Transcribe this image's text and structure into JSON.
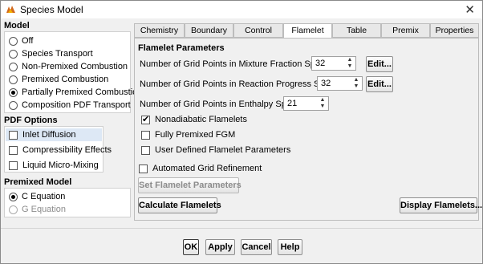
{
  "window": {
    "title": "Species Model",
    "close_icon": "close-icon"
  },
  "model": {
    "title": "Model",
    "options": [
      {
        "label": "Off",
        "selected": false
      },
      {
        "label": "Species Transport",
        "selected": false
      },
      {
        "label": "Non-Premixed Combustion",
        "selected": false
      },
      {
        "label": "Premixed Combustion",
        "selected": false
      },
      {
        "label": "Partially Premixed Combustion",
        "selected": true
      },
      {
        "label": "Composition PDF Transport",
        "selected": false
      }
    ]
  },
  "pdf_options": {
    "title": "PDF Options",
    "items": [
      {
        "label": "Inlet Diffusion",
        "checked": false
      },
      {
        "label": "Compressibility Effects",
        "checked": false
      },
      {
        "label": "Liquid Micro-Mixing",
        "checked": false
      }
    ]
  },
  "premixed_model": {
    "title": "Premixed Model",
    "options": [
      {
        "label": "C Equation",
        "selected": true,
        "enabled": true
      },
      {
        "label": "G Equation",
        "selected": false,
        "enabled": false
      }
    ]
  },
  "tabs": [
    {
      "label": "Chemistry",
      "active": false
    },
    {
      "label": "Boundary",
      "active": false
    },
    {
      "label": "Control",
      "active": false
    },
    {
      "label": "Flamelet",
      "active": true
    },
    {
      "label": "Table",
      "active": false
    },
    {
      "label": "Premix",
      "active": false
    },
    {
      "label": "Properties",
      "active": false
    }
  ],
  "flamelet": {
    "section_title": "Flamelet Parameters",
    "mixture_fraction": {
      "label": "Number of Grid Points in Mixture Fraction Space",
      "value": "32",
      "edit_label": "Edit..."
    },
    "reaction_progress": {
      "label": "Number of Grid Points in Reaction Progress Space",
      "value": "32",
      "edit_label": "Edit..."
    },
    "enthalpy": {
      "label": "Number of Grid Points in Enthalpy Space",
      "value": "21"
    },
    "checks": [
      {
        "label": "Nonadiabatic Flamelets",
        "checked": true
      },
      {
        "label": "Fully Premixed FGM",
        "checked": false
      },
      {
        "label": "User Defined Flamelet Parameters",
        "checked": false
      }
    ],
    "auto_refinement": {
      "label": "Automated Grid Refinement",
      "checked": false
    },
    "set_params_label": "Set Flamelet Parameters",
    "calculate_label": "Calculate Flamelets",
    "display_label": "Display Flamelets..."
  },
  "footer": {
    "ok": "OK",
    "apply": "Apply",
    "cancel": "Cancel",
    "help": "Help"
  },
  "colors": {
    "accent": "#1a56a8",
    "panel": "#f0f0f0",
    "selection": "#dde8f5"
  }
}
